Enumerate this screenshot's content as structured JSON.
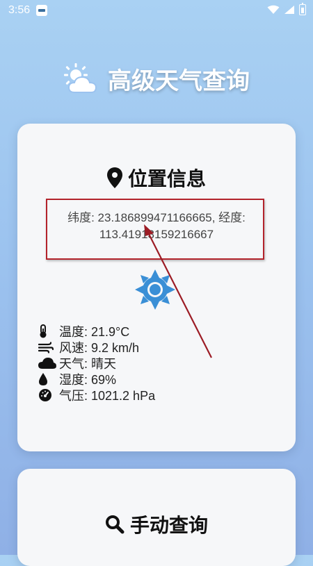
{
  "status_bar": {
    "time": "3:56"
  },
  "app": {
    "title": "高级天气查询"
  },
  "location_card": {
    "title": "位置信息",
    "coordinates": "纬度: 23.186899471166665, 经度: 113.41913159216667",
    "weather": [
      {
        "icon": "thermometer-icon",
        "text": "温度: 21.9°C"
      },
      {
        "icon": "wind-icon",
        "text": "风速: 9.2 km/h"
      },
      {
        "icon": "cloud-icon",
        "text": "天气: 晴天"
      },
      {
        "icon": "droplet-icon",
        "text": "湿度: 69%"
      },
      {
        "icon": "gauge-icon",
        "text": "气压: 1021.2 hPa"
      }
    ]
  },
  "manual_card": {
    "title": "手动查询"
  },
  "colors": {
    "accent": "#3a8fd6",
    "annotation": "#b3232b",
    "card_bg": "#f6f7f9"
  }
}
